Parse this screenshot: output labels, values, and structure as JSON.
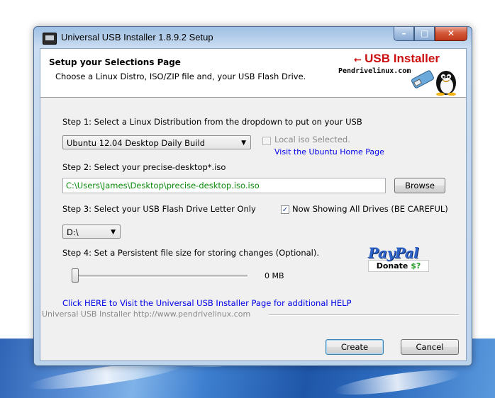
{
  "window": {
    "title": "Universal USB Installer 1.8.9.2 Setup",
    "caption_buttons": {
      "minimize": "–",
      "maximize": "□",
      "close": "✕"
    }
  },
  "header": {
    "title": "Setup your Selections Page",
    "subtitle": "Choose a Linux Distro, ISO/ZIP file and, your USB Flash Drive.",
    "logo_title": "USB Installer",
    "logo_site": "Pendrivelinux.com"
  },
  "step1": {
    "label": "Step 1: Select a Linux Distribution from the dropdown to put on your USB",
    "distro_value": "Ubuntu 12.04 Desktop Daily Build",
    "local_iso_label": "Local iso Selected.",
    "home_link": "Visit the Ubuntu Home Page"
  },
  "step2": {
    "label": "Step 2: Select your precise-desktop*.iso",
    "path_value": "C:\\Users\\James\\Desktop\\precise-desktop.iso.iso",
    "browse_label": "Browse"
  },
  "step3": {
    "label": "Step 3: Select your USB Flash Drive Letter Only",
    "show_all_label": "Now Showing All Drives (BE CAREFUL)",
    "show_all_checked": true,
    "drive_value": "D:\\"
  },
  "step4": {
    "label": "Step 4: Set a Persistent file size for storing changes (Optional).",
    "size_label": "0 MB",
    "slider_fraction": 0
  },
  "paypal": {
    "word": "PayPal",
    "donate_text": "Donate",
    "donate_symbol": "$?"
  },
  "help_link": "Click HERE to Visit the Universal USB Installer Page for additional HELP",
  "footer": {
    "text": "Universal USB Installer http://www.pendrivelinux.com"
  },
  "buttons": {
    "create": "Create",
    "cancel": "Cancel"
  },
  "colors": {
    "link": "#0000e8",
    "path_text": "#0a8a0a",
    "logo_red": "#cc1010",
    "close_button": "#c0391b",
    "paypal_blue": "#2d63c8"
  }
}
